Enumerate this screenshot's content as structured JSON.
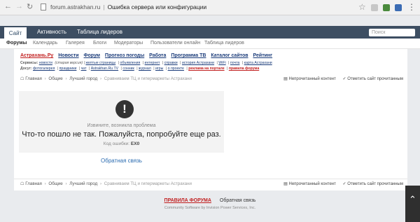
{
  "browser": {
    "url": "forum.astrakhan.ru",
    "title": "Ошибка сервера или конфигурации"
  },
  "topnav": {
    "tabs": [
      "Сайт",
      "Активность",
      "Таблица лидеров"
    ],
    "search_placeholder": "Поиск"
  },
  "subnav": {
    "items": [
      "Форумы",
      "Календарь",
      "Галерея",
      "Блоги",
      "Модераторы",
      "Пользователи онлайн",
      "Таблица лидеров"
    ]
  },
  "portal_links": [
    "Астрахань.Ру",
    "Новости",
    "Форум",
    "Прогноз погоды",
    "Работа",
    "Программа ТВ",
    "Каталог сайтов",
    "Рейтинг"
  ],
  "services": {
    "label": "Сервисы:",
    "links": [
      "новости",
      "(старая версия)",
      "желтые страницы",
      "объявления",
      "интернет",
      "справки",
      "история Астрахани",
      "WiFi",
      "почта",
      "карта Астрахани"
    ]
  },
  "friends": {
    "label": "Досуг:",
    "links": [
      "фотогалерея",
      "праздники",
      "чат",
      "Astrakhan.Ru TV",
      "сонник",
      "журнал",
      "игры",
      "о проекте"
    ],
    "promo": [
      "реклама на портале",
      "правила форума"
    ]
  },
  "breadcrumb": {
    "home": "Главная",
    "items": [
      "Общие",
      "Лучший город",
      "Сравниваем ТЦ и гипермаркеты Астрахани"
    ],
    "actions": [
      "Непрочитанный контент",
      "Отметить сайт прочитанным"
    ]
  },
  "error": {
    "subtitle": "Извините, возникла проблема",
    "message": "Что-то пошло не так. Пожалуйста, попробуйте еще раз.",
    "code_label": "Код ошибки:",
    "code": "EX0",
    "feedback": "Обратная связь"
  },
  "footer": {
    "rules": "ПРАВИЛА ФОРУМА",
    "feedback": "Обратная связь",
    "copyright": "Community Software by Invision Power Services, Inc."
  }
}
